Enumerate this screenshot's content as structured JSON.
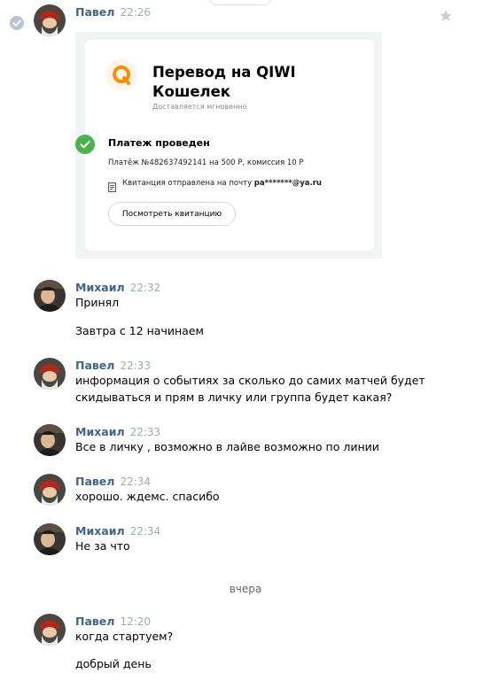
{
  "messages": [
    {
      "author": "Павел",
      "time": "22:26"
    },
    {
      "author": "Михаил",
      "time": "22:32",
      "lines": [
        "Принял",
        "Завтра с 12 начинаем"
      ]
    },
    {
      "author": "Павел",
      "time": "22:33",
      "lines": [
        "информация о событиях за сколько до самих матчей будет",
        "скидываться и прям в личку или группа будет какая?"
      ]
    },
    {
      "author": "Михаил",
      "time": "22:33",
      "lines": [
        "Все в личку , возможно в лайве возможно по линии"
      ]
    },
    {
      "author": "Павел",
      "time": "22:34",
      "lines": [
        "хорошо. ждемс. спасибо"
      ]
    },
    {
      "author": "Михаил",
      "time": "22:34",
      "lines": [
        "Не за что"
      ]
    },
    {
      "author": "Павел",
      "time": "12:20",
      "lines": [
        "когда стартуем?",
        "добрый день"
      ]
    }
  ],
  "qiwi_card": {
    "title_line1": "Перевод на QIWI",
    "title_line2": "Кошелек",
    "subtitle": "Доставляется мгновенно",
    "status": "Платеж проведен",
    "detail": "Платёж №482637492141 на 500 Р, комиссия 10 Р",
    "receipt_prefix": "Квитанция отправлена на почту",
    "receipt_email": "pa*******@ya.ru",
    "button_label": "Посмотреть квитанцию"
  },
  "date_divider": "вчера",
  "icons": {
    "selected": "check-circle-icon",
    "favorite": "star-icon",
    "qiwi": "qiwi-logo-icon",
    "success": "check-icon",
    "receipt": "document-icon"
  },
  "colors": {
    "author": "#42648b",
    "time": "#a0abb9",
    "success": "#4bb34b",
    "qiwi_orange": "#ff8c00",
    "card_background": "#f2f3f5"
  }
}
